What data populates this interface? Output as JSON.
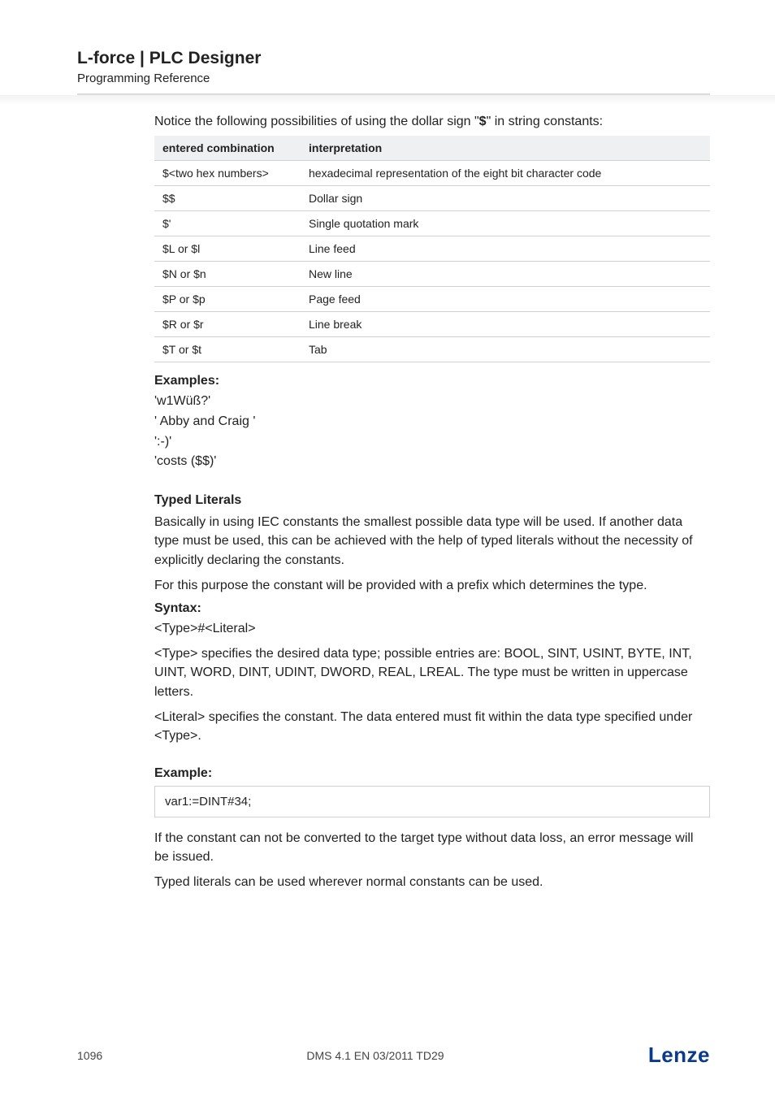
{
  "header": {
    "brand": "L-force | PLC Designer",
    "subref": "Programming Reference"
  },
  "intro": {
    "pre": "Notice the following possibilities of using the dollar sign \"",
    "sym": "$",
    "post": "\" in string constants:"
  },
  "table": {
    "head_col1": "entered combination",
    "head_col2": "interpretation",
    "rows": [
      {
        "c1": "$<two hex numbers>",
        "c2": "hexadecimal representation of the eight bit character code"
      },
      {
        "c1": "$$",
        "c2": "Dollar sign"
      },
      {
        "c1": "$'",
        "c2": "Single quotation mark"
      },
      {
        "c1": "$L  or  $l",
        "c2": "Line feed"
      },
      {
        "c1": "$N  or  $n",
        "c2": "New line"
      },
      {
        "c1": "$P  or  $p",
        "c2": "Page feed"
      },
      {
        "c1": "$R  or  $r",
        "c2": "Line break"
      },
      {
        "c1": "$T  or   $t",
        "c2": "Tab"
      }
    ]
  },
  "examples": {
    "heading": "Examples:",
    "lines": [
      "'w1Wüß?'",
      "' Abby and Craig '",
      "':-)'",
      "'costs ($$)'"
    ]
  },
  "typed": {
    "heading": "Typed Literals",
    "p1": "Basically  in using IEC constants the smallest possible data type will be used. If another data type must be used, this can be achieved with the help of typed literals without the necessity of explicitly declaring the constants.",
    "p2": "For this purpose the constant will be provided with a prefix which determines the type.",
    "syntax_label": "Syntax:",
    "syntax_line": "<Type>#<Literal>",
    "p3": "<Type> specifies the desired data type; possible entries are: BOOL, SINT, USINT, BYTE, INT, UINT, WORD, DINT, UDINT, DWORD, REAL, LREAL. The type must be written in uppercase letters.",
    "p4": "<Literal> specifies the constant. The data entered must fit within the data type specified under <Type>."
  },
  "example2": {
    "heading": "Example:",
    "code": "var1:=DINT#34;",
    "p1": "If the constant can not be converted to the target type without data loss, an error message will be issued.",
    "p2": "Typed literals can be used wherever normal constants can be used."
  },
  "footer": {
    "page": "1096",
    "docid": "DMS 4.1 EN 03/2011 TD29",
    "logo": "Lenze"
  }
}
